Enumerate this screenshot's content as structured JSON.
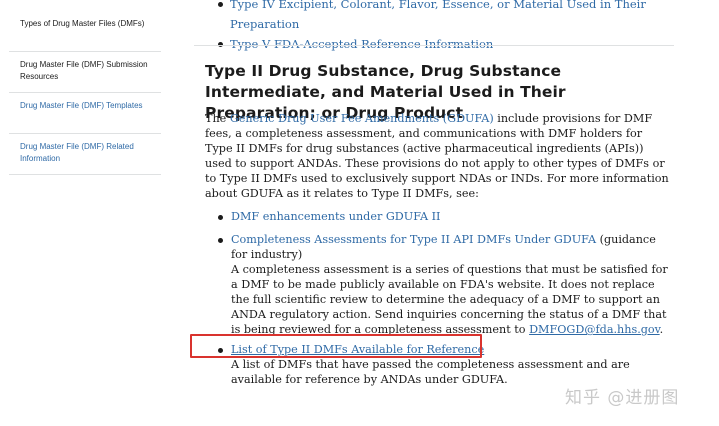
{
  "sidebar": {
    "items": [
      {
        "label": "Types of Drug Master Files (DMFs)"
      },
      {
        "label": "Drug Master File (DMF) Submission Resources"
      },
      {
        "label": "Drug Master File (DMF) Templates"
      },
      {
        "label": "Drug Master File (DMF) Related Information"
      }
    ]
  },
  "top_list": [
    "Type IV Excipient, Colorant, Flavor, Essence, or Material Used in Their Preparation",
    "Type V FDA-Accepted Reference Information"
  ],
  "section": {
    "heading": "Type II Drug Substance, Drug Substance Intermediate, and Material Used in Their Preparation; or Drug Product",
    "intro_pre": "The ",
    "intro_link": "Generic Drug User Fee Amendments (GDUFA)",
    "intro_post": " include provisions for DMF fees, a completeness assessment, and communications with DMF holders for Type II DMFs for drug substances (active pharmaceutical ingredients (APIs)) used to support ANDAs. These provisions do not apply to other types of DMFs or to Type II DMFs used to exclusively support NDAs or INDs. For more information about GDUFA as it relates to Type II DMFs, see:"
  },
  "links": {
    "enhancements": "DMF enhancements under GDUFA II",
    "completeness_title": "Completeness Assessments for Type II API DMFs Under GDUFA",
    "completeness_suffix": " (guidance for industry)",
    "completeness_desc": "A completeness assessment is a series of questions that must be satisfied for a DMF to be made publicly available on FDA's website. It does not replace the full scientific review to determine the adequacy of a DMF to support an ANDA regulatory action. Send inquiries concerning the status of a DMF that is being reviewed for a completeness assessment to ",
    "email": "DMFOGD@fda.hhs.gov",
    "email_suffix": ".",
    "list_title": "List of Type II DMFs Available for Reference",
    "list_desc": "A list of DMFs that have passed the completeness assessment and are available for reference by ANDAs under GDUFA."
  },
  "watermark": "知乎 @进册图",
  "colors": {
    "link": "#2f6aa6",
    "highlight": "#d9332e",
    "text": "#1b1b1b"
  }
}
